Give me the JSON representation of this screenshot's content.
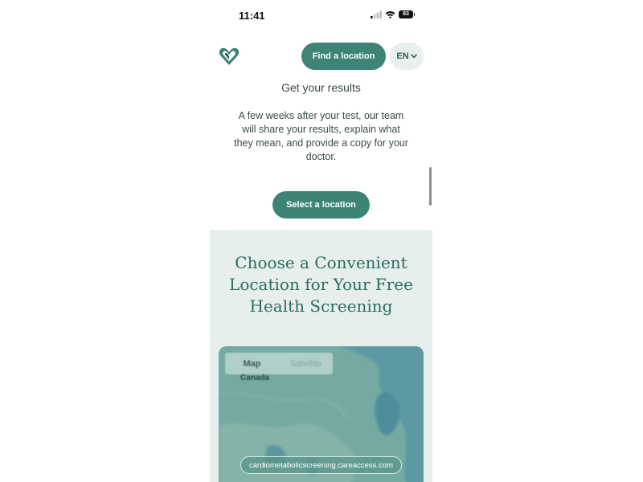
{
  "status_bar": {
    "time": "11:41",
    "battery": "83"
  },
  "header": {
    "logo_icon": "heart-logo-icon",
    "find_location_label": "Find a location",
    "language_label": "EN"
  },
  "results": {
    "title": "Get your results",
    "body": "A few weeks after your test, our team will share your results, explain what they mean, and provide a copy for your doctor.",
    "select_location_label": "Select a location"
  },
  "choose": {
    "title": "Choose a Convenient Location for Your Free Health Screening"
  },
  "map": {
    "tabs": [
      {
        "label": "Map",
        "active": true
      },
      {
        "label": "Satellite",
        "active": false
      }
    ],
    "region_label": "Canada",
    "url": "cardiometabolicscreening.careaccess.com"
  },
  "colors": {
    "brand_green": "#3d8376",
    "section_bg": "#e6efec",
    "heading_green": "#2d6b61"
  }
}
